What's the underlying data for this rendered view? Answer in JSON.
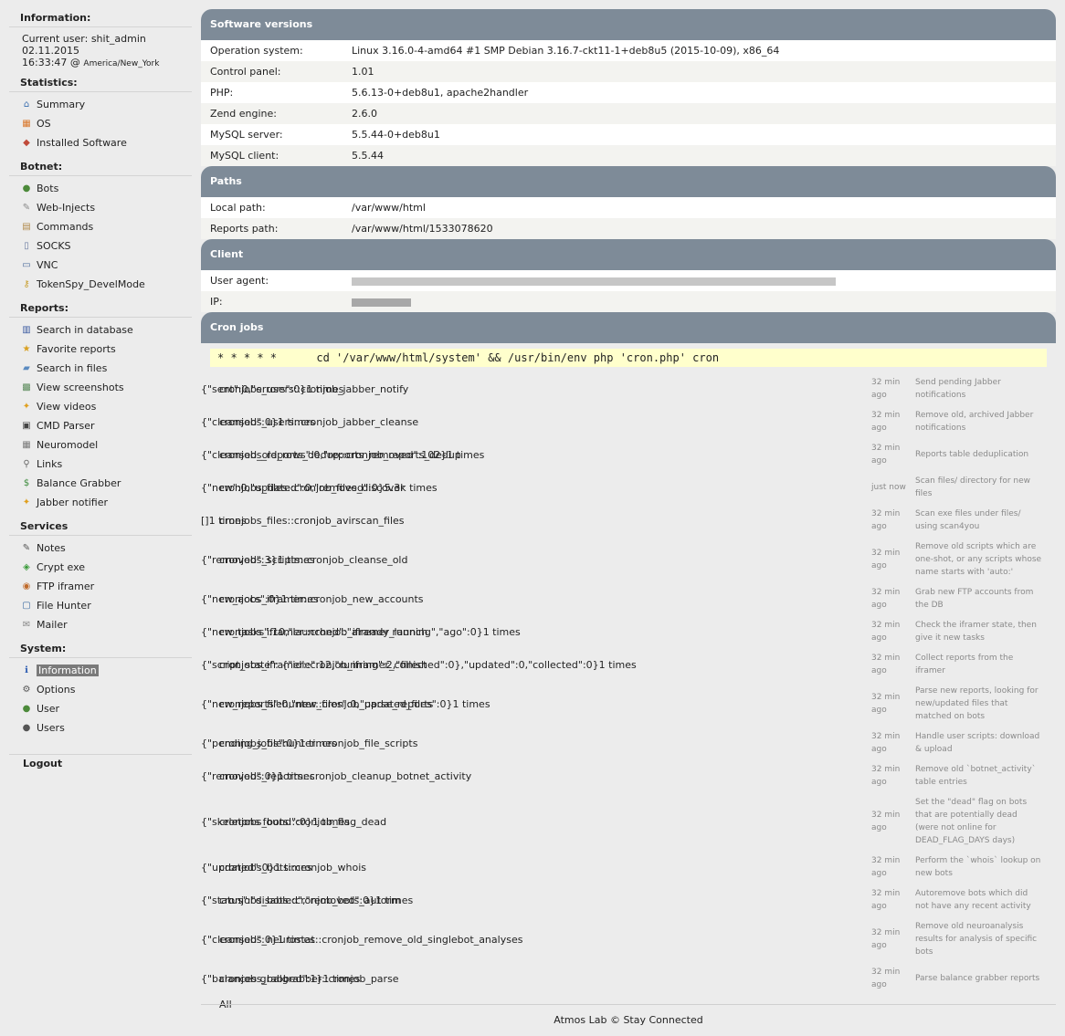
{
  "sidebar": {
    "info_heading": "Information:",
    "current_user": "Current user: shit_admin",
    "date": "02.11.2015",
    "time": "16:33:47 @",
    "timezone": "America/New_York",
    "statistics_heading": "Statistics:",
    "statistics": [
      {
        "label": "Summary",
        "icon": "home-icon"
      },
      {
        "label": "OS",
        "icon": "windows-icon"
      },
      {
        "label": "Installed Software",
        "icon": "package-icon"
      }
    ],
    "botnet_heading": "Botnet:",
    "botnet": [
      {
        "label": "Bots",
        "icon": "user-icon"
      },
      {
        "label": "Web-Injects",
        "icon": "syringe-icon"
      },
      {
        "label": "Commands",
        "icon": "clipboard-icon"
      },
      {
        "label": "SOCKS",
        "icon": "document-icon"
      },
      {
        "label": "VNC",
        "icon": "monitor-icon"
      },
      {
        "label": "TokenSpy_DevelMode",
        "icon": "key-icon"
      }
    ],
    "reports_heading": "Reports:",
    "reports": [
      {
        "label": "Search in database",
        "icon": "book-icon"
      },
      {
        "label": "Favorite reports",
        "icon": "folder-star-icon"
      },
      {
        "label": "Search in files",
        "icon": "folder-icon"
      },
      {
        "label": "View screenshots",
        "icon": "image-icon"
      },
      {
        "label": "View videos",
        "icon": "lightbulb-icon"
      },
      {
        "label": "CMD Parser",
        "icon": "terminal-icon"
      },
      {
        "label": "Neuromodel",
        "icon": "grid-icon"
      },
      {
        "label": "Links",
        "icon": "magnifier-icon"
      },
      {
        "label": "Balance Grabber",
        "icon": "dollar-icon"
      },
      {
        "label": "Jabber notifier",
        "icon": "lightbulb-icon"
      }
    ],
    "services_heading": "Services",
    "services": [
      {
        "label": "Notes",
        "icon": "pencil-icon"
      },
      {
        "label": "Crypt exe",
        "icon": "shield-icon"
      },
      {
        "label": "FTP iframer",
        "icon": "ftp-icon"
      },
      {
        "label": "File Hunter",
        "icon": "window-icon"
      },
      {
        "label": "Mailer",
        "icon": "mail-icon"
      }
    ],
    "system_heading": "System:",
    "system": [
      {
        "label": "Information",
        "icon": "info-icon",
        "active": true
      },
      {
        "label": "Options",
        "icon": "gear-icon"
      },
      {
        "label": "User",
        "icon": "user-icon"
      },
      {
        "label": "Users",
        "icon": "users-icon"
      }
    ],
    "logout": "Logout"
  },
  "software": {
    "title": "Software versions",
    "rows": [
      {
        "k": "Operation system:",
        "v": "Linux 3.16.0-4-amd64 #1 SMP Debian 3.16.7-ckt11-1+deb8u5 (2015-10-09), x86_64"
      },
      {
        "k": "Control panel:",
        "v": "1.01"
      },
      {
        "k": "PHP:",
        "v": "5.6.13-0+deb8u1, apache2handler"
      },
      {
        "k": "Zend engine:",
        "v": "2.6.0"
      },
      {
        "k": "MySQL server:",
        "v": "5.5.44-0+deb8u1"
      },
      {
        "k": "MySQL client:",
        "v": "5.5.44"
      }
    ]
  },
  "paths": {
    "title": "Paths",
    "rows": [
      {
        "k": "Local path:",
        "v": "/var/www/html"
      },
      {
        "k": "Reports path:",
        "v": "/var/www/html/1533078620"
      }
    ]
  },
  "client": {
    "title": "Client",
    "user_agent_label": "User agent:",
    "ip_label": "IP:"
  },
  "cron": {
    "title": "Cron jobs",
    "command": "* * * * *      cd '/var/www/html/system' && /usr/bin/env php 'cron.php' cron",
    "jobs": [
      {
        "name": "cronjobs_users::cronjob_jabber_notify",
        "result": "{\"sent\":0,\"errors\":0}",
        "count": "1 times",
        "ago": "32 min ago",
        "desc": "Send pending Jabber notifications"
      },
      {
        "name": "cronjobs_users::cronjob_jabber_cleanse",
        "result": "{\"cleansed\":0}",
        "count": "1 times",
        "ago": "32 min ago",
        "desc": "Remove old, archived Jabber notifications"
      },
      {
        "name": "cronjobs_reports_dedup::cronjob_reports_dedup",
        "result": "{\"cleansed_old_rows\":0,\"reports_removed\":102}",
        "count": "1 times",
        "ago": "32 min ago",
        "desc": "Reports table deduplication"
      },
      {
        "name": "cronjobs_files::cronjob_files_discover",
        "result": "{\"new\":0,\"updated\":0,\"removed\":0}",
        "count": "5.3k times",
        "ago": "just now",
        "desc": "Scan files/ directory for new files"
      },
      {
        "name": "cronjobs_files::cronjob_avirscan_files",
        "result": "[]",
        "count": "1 times",
        "ago": "32 min ago",
        "desc": "Scan exe files under files/ using scan4you"
      },
      {
        "name": "cronjobs_scripts::cronjob_cleanse_old",
        "result": "{\"removed\":3}",
        "count": "1 times",
        "ago": "32 min ago",
        "desc": "Remove old scripts which are one-shot, or any scripts whose name starts with 'auto:'"
      },
      {
        "name": "cronjobs_iframer::cronjob_new_accounts",
        "result": "{\"new_accs\":0}",
        "count": "1 times",
        "ago": "32 min ago",
        "desc": "Grab new FTP accounts from the DB"
      },
      {
        "name": "cronjobs_iframer::cronjob_iframer_launch",
        "result": "{\"new_tasks\":10,\"launched\":\"already running\",\"ago\":0}",
        "count": "1 times",
        "ago": "32 min ago",
        "desc": "Check the iframer state, then give it new tasks"
      },
      {
        "name": "cronjobs_iframer::cronjob_iframer_collect",
        "result": "{\"script_state\": {\"idle\":12,\"running\":2,\"finished\":0},\"updated\":0,\"collected\":0}",
        "count": "1 times",
        "ago": "32 min ago",
        "desc": "Collect reports from the iframer"
      },
      {
        "name": "cronjobs_filehunter::cronjob_parse_reports",
        "result": "{\"new_reports\":0,\"new_files\":0,\"updated_files\":0}",
        "count": "1 times",
        "ago": "32 min ago",
        "desc": "Parse new reports, looking for new/updated files that matched on bots"
      },
      {
        "name": "cronjobs_filehunter::cronjob_file_scripts",
        "result": "{\"pending_jobs\":0}",
        "count": "1 times",
        "ago": "32 min ago",
        "desc": "Handle user scripts: download & upload"
      },
      {
        "name": "cronjobs_reports::cronjob_cleanup_botnet_activity",
        "result": "{\"removed\":0}",
        "count": "1 times",
        "ago": "32 min ago",
        "desc": "Remove old `botnet_activity` table entries"
      },
      {
        "name": "cronjobs_bots::cronjob_flag_dead",
        "result": "{\"skeletons found\":0}",
        "count": "1 times",
        "ago": "32 min ago",
        "desc": "Set the \"dead\" flag on bots that are potentially dead (were not online for DEAD_FLAG_DAYS days)"
      },
      {
        "name": "cronjobs_bots::cronjob_whois",
        "result": "{\"updated\":0}",
        "count": "1 times",
        "ago": "32 min ago",
        "desc": "Perform the `whois` lookup on new bots"
      },
      {
        "name": "cronjobs_bots::cronjob_bots_autorm",
        "result": "{\"status\":\"disabled\",\"removed\":0}",
        "count": "1 times",
        "ago": "32 min ago",
        "desc": "Autoremove bots which did not have any recent activity"
      },
      {
        "name": "cronjobs_neurostat::cronjob_remove_old_singlebot_analyses",
        "result": "{\"cleansed\":0}",
        "count": "1 times",
        "ago": "32 min ago",
        "desc": "Remove old neuroanalysis results for analysis of specific bots"
      },
      {
        "name": "cronjobs_balgrabber::cronjob_parse",
        "result": "{\"balances grabbed\":1}",
        "count": "1 times",
        "ago": "32 min ago",
        "desc": "Parse balance grabber reports"
      }
    ],
    "all_link": "All"
  },
  "footer": "Atmos Lab © Stay Connected"
}
